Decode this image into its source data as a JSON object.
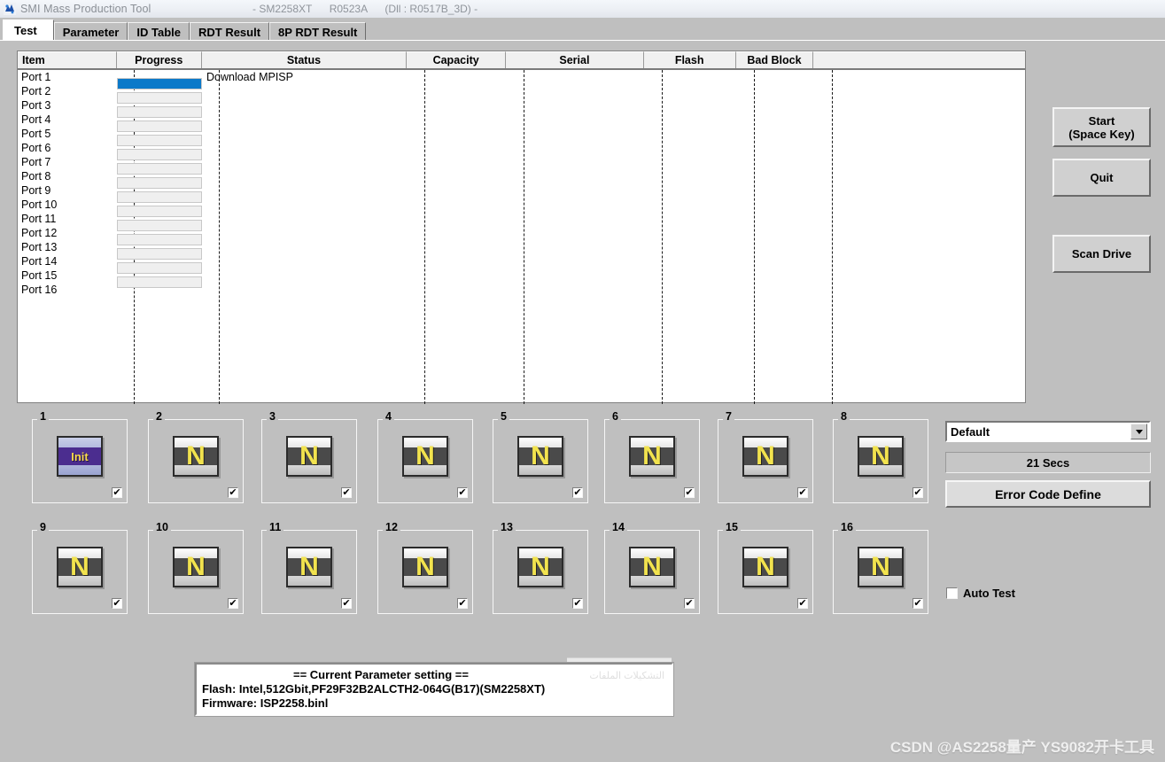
{
  "window": {
    "title": "SMI Mass Production Tool",
    "icon": "app-icon",
    "meta": [
      "- SM2258XT",
      "R0523A",
      "(Dll : R0517B_3D) -"
    ]
  },
  "tabs": [
    {
      "label": "Test",
      "active": true
    },
    {
      "label": "Parameter",
      "active": false
    },
    {
      "label": "ID Table",
      "active": false
    },
    {
      "label": "RDT Result",
      "active": false
    },
    {
      "label": "8P RDT Result",
      "active": false
    }
  ],
  "grid": {
    "columns": [
      "Item",
      "Progress",
      "Status",
      "Capacity",
      "Serial",
      "Flash",
      "Bad Block",
      ""
    ],
    "rows": [
      {
        "item": "Port 1",
        "progress": 100,
        "status": "Download MPISP",
        "capacity": "",
        "serial": "",
        "flash": "",
        "bad_block": ""
      },
      {
        "item": "Port 2",
        "progress": 0,
        "status": "",
        "capacity": "",
        "serial": "",
        "flash": "",
        "bad_block": ""
      },
      {
        "item": "Port 3",
        "progress": 0,
        "status": "",
        "capacity": "",
        "serial": "",
        "flash": "",
        "bad_block": ""
      },
      {
        "item": "Port 4",
        "progress": 0,
        "status": "",
        "capacity": "",
        "serial": "",
        "flash": "",
        "bad_block": ""
      },
      {
        "item": "Port 5",
        "progress": 0,
        "status": "",
        "capacity": "",
        "serial": "",
        "flash": "",
        "bad_block": ""
      },
      {
        "item": "Port 6",
        "progress": 0,
        "status": "",
        "capacity": "",
        "serial": "",
        "flash": "",
        "bad_block": ""
      },
      {
        "item": "Port 7",
        "progress": 0,
        "status": "",
        "capacity": "",
        "serial": "",
        "flash": "",
        "bad_block": ""
      },
      {
        "item": "Port 8",
        "progress": 0,
        "status": "",
        "capacity": "",
        "serial": "",
        "flash": "",
        "bad_block": ""
      },
      {
        "item": "Port 9",
        "progress": 0,
        "status": "",
        "capacity": "",
        "serial": "",
        "flash": "",
        "bad_block": ""
      },
      {
        "item": "Port 10",
        "progress": 0,
        "status": "",
        "capacity": "",
        "serial": "",
        "flash": "",
        "bad_block": ""
      },
      {
        "item": "Port 11",
        "progress": 0,
        "status": "",
        "capacity": "",
        "serial": "",
        "flash": "",
        "bad_block": ""
      },
      {
        "item": "Port 12",
        "progress": 0,
        "status": "",
        "capacity": "",
        "serial": "",
        "flash": "",
        "bad_block": ""
      },
      {
        "item": "Port 13",
        "progress": 0,
        "status": "",
        "capacity": "",
        "serial": "",
        "flash": "",
        "bad_block": ""
      },
      {
        "item": "Port 14",
        "progress": 0,
        "status": "",
        "capacity": "",
        "serial": "",
        "flash": "",
        "bad_block": ""
      },
      {
        "item": "Port 15",
        "progress": 0,
        "status": "",
        "capacity": "",
        "serial": "",
        "flash": "",
        "bad_block": ""
      },
      {
        "item": "Port 16",
        "progress": null,
        "status": "",
        "capacity": "",
        "serial": "",
        "flash": "",
        "bad_block": ""
      }
    ]
  },
  "actions": {
    "start": "Start\n(Space Key)",
    "start_line1": "Start",
    "start_line2": "(Space Key)",
    "quit": "Quit",
    "scan_drive": "Scan Drive"
  },
  "side": {
    "preset_selected": "Default",
    "elapsed": "21 Secs",
    "error_code_define": "Error Code Define",
    "auto_test_label": "Auto Test",
    "auto_test_checked": false
  },
  "ports": [
    {
      "num": "1",
      "state": "Init",
      "checked": true
    },
    {
      "num": "2",
      "state": "N",
      "checked": true
    },
    {
      "num": "3",
      "state": "N",
      "checked": true
    },
    {
      "num": "4",
      "state": "N",
      "checked": true
    },
    {
      "num": "5",
      "state": "N",
      "checked": true
    },
    {
      "num": "6",
      "state": "N",
      "checked": true
    },
    {
      "num": "7",
      "state": "N",
      "checked": true
    },
    {
      "num": "8",
      "state": "N",
      "checked": true
    },
    {
      "num": "9",
      "state": "N",
      "checked": true
    },
    {
      "num": "10",
      "state": "N",
      "checked": true
    },
    {
      "num": "11",
      "state": "N",
      "checked": true
    },
    {
      "num": "12",
      "state": "N",
      "checked": true
    },
    {
      "num": "13",
      "state": "N",
      "checked": true
    },
    {
      "num": "14",
      "state": "N",
      "checked": true
    },
    {
      "num": "15",
      "state": "N",
      "checked": true
    },
    {
      "num": "16",
      "state": "N",
      "checked": true
    }
  ],
  "parameter_panel": {
    "title": "== Current Parameter setting ==",
    "flash_label": "Flash:",
    "flash_value": "Intel,512Gbit,PF29F32B2ALCTH2-064G(B17)(SM2258XT)",
    "firmware_label": "Firmware:",
    "firmware_value": "ISP2258.binl",
    "flash_line": "Flash:   Intel,512Gbit,PF29F32B2ALCTH2-064G(B17)(SM2258XT)",
    "firmware_line": "Firmware:   ISP2258.binl"
  },
  "watermark": "CSDN @AS2258量产 YS9082开卡工具",
  "colors": {
    "progress_fill": "#0b79c9",
    "window_bg": "#bfbfbf",
    "glyph_yellow": "#f2e34e",
    "init_purple": "#4b2d8f"
  },
  "checkmark": "✔"
}
